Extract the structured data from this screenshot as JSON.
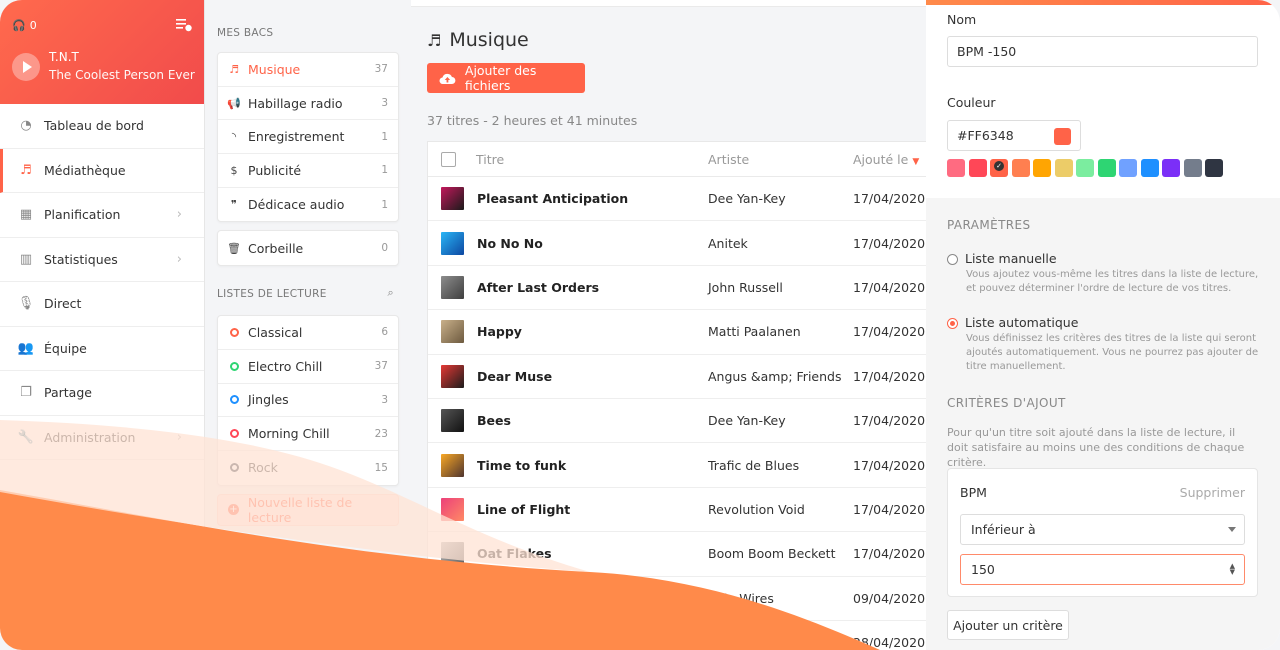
{
  "player": {
    "listeners": "0",
    "station": "T.N.T",
    "slogan": "The Coolest Person Ever"
  },
  "nav": {
    "items": [
      {
        "label": "Tableau de bord",
        "icon": "dashboard-icon",
        "active": false,
        "chevron": false
      },
      {
        "label": "Médiathèque",
        "icon": "music-note-icon",
        "active": true,
        "chevron": false
      },
      {
        "label": "Planification",
        "icon": "calendar-icon",
        "active": false,
        "chevron": true
      },
      {
        "label": "Statistiques",
        "icon": "bar-chart-icon",
        "active": false,
        "chevron": true
      },
      {
        "label": "Direct",
        "icon": "microphone-icon",
        "active": false,
        "chevron": false
      },
      {
        "label": "Équipe",
        "icon": "users-icon",
        "active": false,
        "chevron": false
      },
      {
        "label": "Partage",
        "icon": "share-icon",
        "active": false,
        "chevron": false
      },
      {
        "label": "Administration",
        "icon": "wrench-icon",
        "active": false,
        "chevron": true
      }
    ]
  },
  "bins": {
    "section_label": "MES BACS",
    "items": [
      {
        "label": "Musique",
        "count": "37",
        "icon": "music-note-icon",
        "active": true
      },
      {
        "label": "Habillage radio",
        "count": "3",
        "icon": "megaphone-icon",
        "active": false
      },
      {
        "label": "Enregistrement",
        "count": "1",
        "icon": "rss-icon",
        "active": false
      },
      {
        "label": "Publicité",
        "count": "1",
        "icon": "dollar-icon",
        "active": false
      },
      {
        "label": "Dédicace audio",
        "count": "1",
        "icon": "quote-icon",
        "active": false
      }
    ],
    "trash": {
      "label": "Corbeille",
      "count": "0"
    }
  },
  "playlists": {
    "section_label": "LISTES DE LECTURE",
    "items": [
      {
        "label": "Classical",
        "count": "6",
        "color": "#FF6348"
      },
      {
        "label": "Electro Chill",
        "count": "37",
        "color": "#2ED573"
      },
      {
        "label": "Jingles",
        "count": "3",
        "color": "#1E90FF"
      },
      {
        "label": "Morning Chill",
        "count": "23",
        "color": "#FF4757"
      },
      {
        "label": "Rock",
        "count": "15",
        "color": "#2F3542"
      }
    ],
    "new_label": "Nouvelle liste de lecture"
  },
  "main": {
    "title": "Musique",
    "add_button": "Ajouter des fichiers",
    "summary": "37 titres - 2 heures et 41 minutes",
    "columns": {
      "title": "Titre",
      "artist": "Artiste",
      "added": "Ajouté le"
    },
    "rows": [
      {
        "title": "Pleasant Anticipation",
        "artist": "Dee Yan-Key",
        "date": "17/04/2020",
        "art": [
          "#c2185b",
          "#1a1a1a"
        ]
      },
      {
        "title": "No No No",
        "artist": "Anitek",
        "date": "17/04/2020",
        "art": [
          "#29b6f6",
          "#0d47a1"
        ]
      },
      {
        "title": "After Last Orders",
        "artist": "John Russell",
        "date": "17/04/2020",
        "art": [
          "#8d8d8d",
          "#3e3e3e"
        ]
      },
      {
        "title": "Happy",
        "artist": "Matti Paalanen",
        "date": "17/04/2020",
        "art": [
          "#c9b08a",
          "#6d5a3f"
        ]
      },
      {
        "title": "Dear Muse",
        "artist": "Angus &amp; Friends",
        "date": "17/04/2020",
        "art": [
          "#e53935",
          "#1b1b1b"
        ]
      },
      {
        "title": "Bees",
        "artist": "Dee Yan-Key",
        "date": "17/04/2020",
        "art": [
          "#555555",
          "#111111"
        ]
      },
      {
        "title": "Time to funk",
        "artist": "Trafic de Blues",
        "date": "17/04/2020",
        "art": [
          "#f9a825",
          "#4e342e"
        ]
      },
      {
        "title": "Line of Flight",
        "artist": "Revolution Void",
        "date": "17/04/2020",
        "art": [
          "#ec407a",
          "#ff8a65"
        ]
      },
      {
        "title": "Oat Flakes",
        "artist": "Boom Boom Beckett",
        "date": "17/04/2020",
        "art": [
          "#bdbdbd",
          "#616161"
        ]
      },
      {
        "title": "",
        "artist": "Spin Wires",
        "date": "09/04/2020",
        "art": [
          "#9e9e9e",
          "#424242"
        ]
      },
      {
        "title": "",
        "artist": "",
        "date": "28/04/2020",
        "art": [
          "#a1887f",
          "#4e342e"
        ]
      }
    ]
  },
  "editor": {
    "name_label": "Nom",
    "name_value": "BPM -150",
    "color_label": "Couleur",
    "color_value": "#FF6348",
    "palette": [
      "#FF6B81",
      "#FF4757",
      "#FF6348",
      "#FF7F50",
      "#FFA502",
      "#ECCC68",
      "#7BED9F",
      "#2ED573",
      "#70A1FF",
      "#1E90FF",
      "#7B2FF7",
      "#747D8C",
      "#2F3542"
    ],
    "params_label": "PARAMÈTRES",
    "manual_title": "Liste manuelle",
    "manual_desc": "Vous ajoutez vous-même les titres dans la liste de lecture, et pouvez déterminer l'ordre de lecture de vos titres.",
    "auto_title": "Liste automatique",
    "auto_desc": "Vous définissez les critères des titres de la liste qui seront ajoutés automatiquement. Vous ne pourrez pas ajouter de titre manuellement.",
    "criteria_label": "CRITÈRES D'AJOUT",
    "criteria_help": "Pour qu'un titre soit ajouté dans la liste de lecture, il doit satisfaire au moins une des conditions de chaque critère.",
    "criterion": {
      "name": "BPM",
      "delete_label": "Supprimer",
      "operator": "Inférieur à",
      "value": "150"
    },
    "add_criterion": "Ajouter un critère"
  }
}
